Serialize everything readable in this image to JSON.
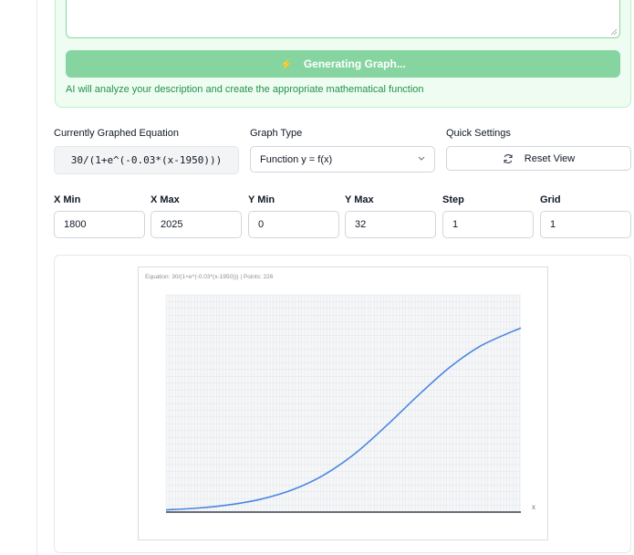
{
  "prompt": {
    "generate_label": "Generating Graph...",
    "note": "AI will analyze your description and create the appropriate mathematical function"
  },
  "controls": {
    "equation_label": "Currently Graphed Equation",
    "equation": "30/(1+e^(-0.03*(x-1950)))",
    "graph_type_label": "Graph Type",
    "graph_type_value": "Function y = f(x)",
    "quick_settings_label": "Quick Settings",
    "reset_label": "Reset View"
  },
  "ranges": {
    "xmin_label": "X Min",
    "xmin": "1800",
    "xmax_label": "X Max",
    "xmax": "2025",
    "ymin_label": "Y Min",
    "ymin": "0",
    "ymax_label": "Y Max",
    "ymax": "32",
    "step_label": "Step",
    "step": "1",
    "grid_label": "Grid",
    "grid": "1"
  },
  "chart_data": {
    "type": "line",
    "caption": "Equation: 30/(1+e^(-0.03*(x-1950))) | Points: 226",
    "xlabel": "x",
    "xlim": [
      1800,
      2025
    ],
    "ylim": [
      0,
      32
    ],
    "grid": true,
    "series": [
      {
        "color": "#4a86e0",
        "x": [
          1800,
          1820,
          1840,
          1860,
          1880,
          1900,
          1920,
          1940,
          1960,
          1980,
          2000,
          2025
        ],
        "y": [
          0.33,
          0.59,
          1.07,
          1.89,
          3.27,
          5.46,
          8.66,
          12.78,
          17.22,
          21.34,
          24.54,
          27.13
        ]
      }
    ]
  }
}
